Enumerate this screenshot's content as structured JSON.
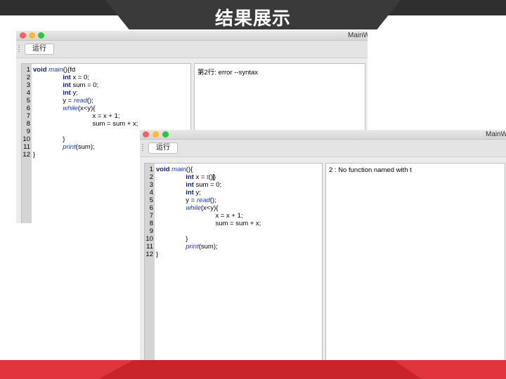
{
  "slide": {
    "title": "结果展示"
  },
  "window1": {
    "title": "MainW",
    "run_label": "运行",
    "line_numbers": "1\n2\n3\n4\n5\n6\n7\n8\n9\n10\n11\n12",
    "output": "第2行: error --syntax"
  },
  "window2": {
    "title": "MainW",
    "run_label": "运行",
    "line_numbers": "1\n2\n3\n4\n5\n6\n7\n8\n9\n10\n11\n12",
    "output": "2 : No function named with t"
  },
  "code1": {
    "l1_kw": "void",
    "l1_fn": "main",
    "l1_rest": "(){fd",
    "l2_kw": "int",
    "l2_rest": " x = 0;",
    "l3_kw": "int",
    "l3_rest": " sum = 0;",
    "l4_kw": "int",
    "l4_rest": " y;",
    "l5_pre": "y = ",
    "l5_fn": "read",
    "l5_rest": "();",
    "l6_fn": "while",
    "l6_rest": "(x<y){",
    "l7": "x = x + 1;",
    "l8": "sum = sum + x;",
    "l10": "}",
    "l11_fn": "print",
    "l11_rest": "(sum);",
    "l12": "}"
  },
  "code2": {
    "l1_kw": "void",
    "l1_fn": "main",
    "l1_rest": "(){",
    "l2_kw": "int",
    "l2_mid": " x = ",
    "l2_fn": "t",
    "l2_rest": "()",
    "l2_end": "}",
    "l3_kw": "int",
    "l3_rest": " sum = 0;",
    "l4_kw": "int",
    "l4_rest": " y;",
    "l5_pre": "y = ",
    "l5_fn": "read",
    "l5_rest": "();",
    "l6_fn": "while",
    "l6_rest": "(x<y){",
    "l7": "x = x + 1;",
    "l8": "sum = sum + x;",
    "l10": "}",
    "l11_fn": "print",
    "l11_rest": "(sum);",
    "l12": "}"
  }
}
